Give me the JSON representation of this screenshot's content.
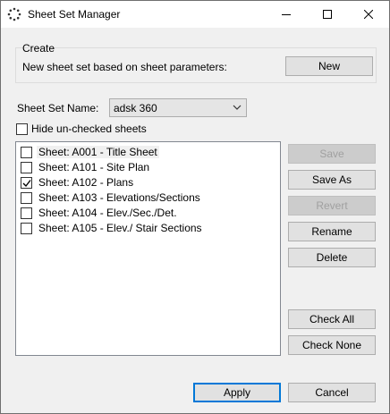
{
  "window": {
    "title": "Sheet Set Manager"
  },
  "create_group": {
    "title": "Create",
    "description": "New sheet set based on sheet parameters:",
    "new_label": "New"
  },
  "sheet_set_name": {
    "label": "Sheet Set Name:",
    "value": "adsk 360"
  },
  "hide_unchecked": {
    "label": "Hide un-checked sheets",
    "checked": false
  },
  "sheets": [
    {
      "label": "Sheet: A001 - Title Sheet",
      "checked": false
    },
    {
      "label": "Sheet: A101 - Site Plan",
      "checked": false
    },
    {
      "label": "Sheet: A102 - Plans",
      "checked": true
    },
    {
      "label": "Sheet: A103 - Elevations/Sections",
      "checked": false
    },
    {
      "label": "Sheet: A104 - Elev./Sec./Det.",
      "checked": false
    },
    {
      "label": "Sheet: A105 - Elev./ Stair Sections",
      "checked": false
    }
  ],
  "side_buttons": {
    "save": "Save",
    "save_as": "Save As",
    "revert": "Revert",
    "rename": "Rename",
    "delete": "Delete",
    "check_all": "Check All",
    "check_none": "Check None"
  },
  "footer": {
    "apply": "Apply",
    "cancel": "Cancel"
  },
  "colors": {
    "focus_border": "#0078d7",
    "disabled_text": "#a0a0a0"
  }
}
